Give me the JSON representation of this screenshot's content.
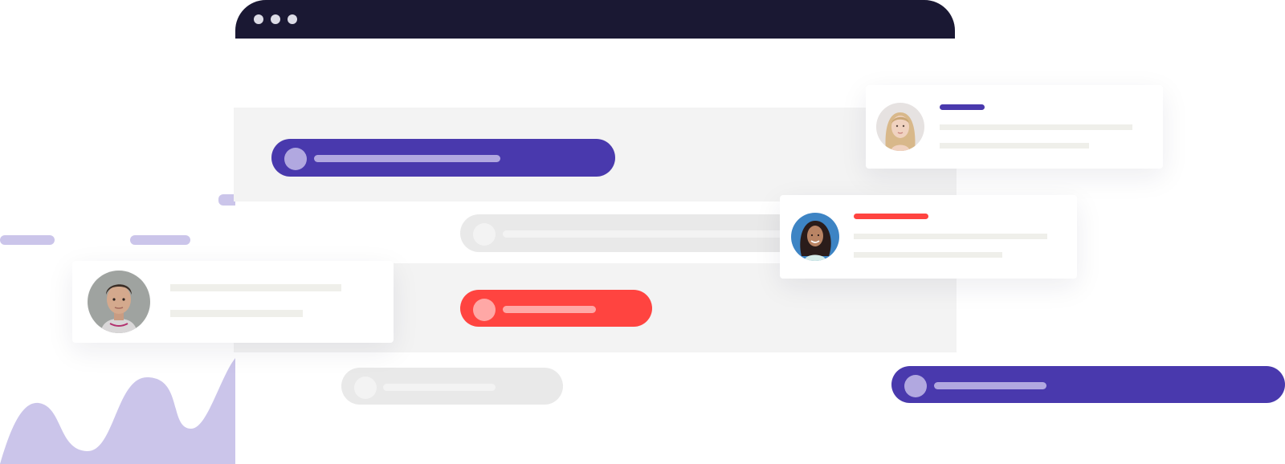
{
  "colors": {
    "titlebar": "#1a1833",
    "purple": "#4939ad",
    "purple_soft": "#b1a8e0",
    "red": "#ff4440",
    "red_soft": "#ffa8a6",
    "gray_pill": "#e9e9e9",
    "band": "#f3f3f3",
    "wave": "#cbc5ea"
  },
  "icons": {
    "window_dots": [
      "window-dot-icon",
      "window-dot-icon",
      "window-dot-icon"
    ],
    "decoration": "wave-chart-icon"
  },
  "cards": [
    {
      "name": "user-card-man",
      "avatar": "man-avatar",
      "accent": "none"
    },
    {
      "name": "user-card-blonde-woman",
      "avatar": "blonde-woman-avatar",
      "accent": "#4939ad"
    },
    {
      "name": "user-card-dark-hair-woman",
      "avatar": "dark-hair-woman-avatar",
      "accent": "#ff4440"
    }
  ]
}
